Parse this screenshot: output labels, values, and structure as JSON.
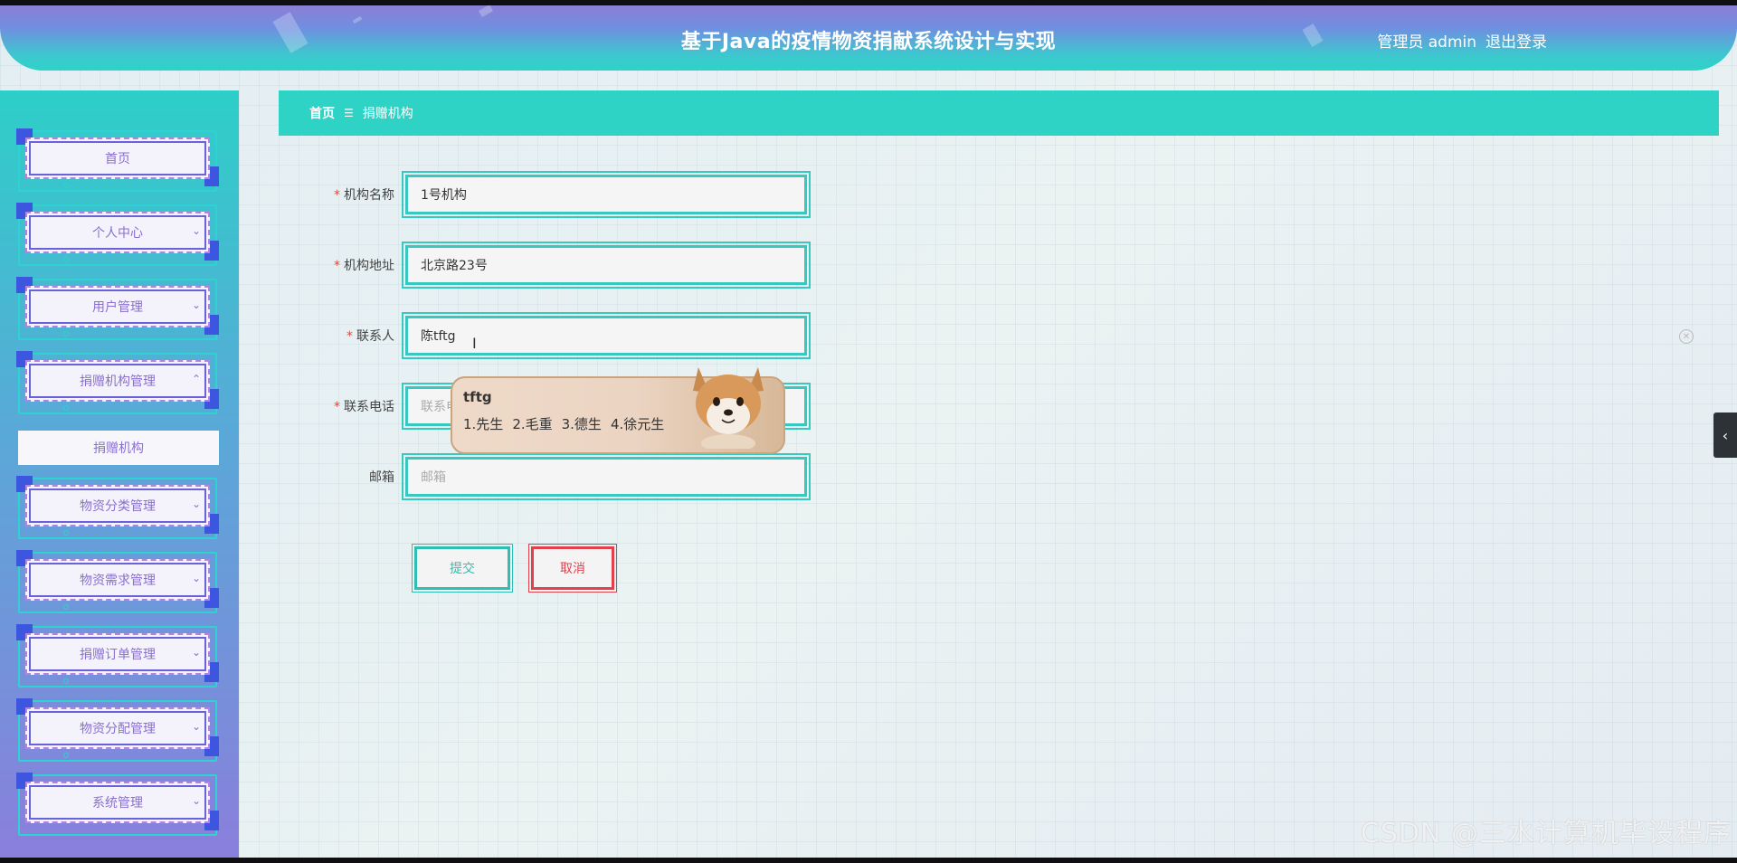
{
  "header": {
    "title": "基于Java的疫情物资捐献系统设计与实现",
    "user_label": "管理员 admin",
    "logout_label": "退出登录"
  },
  "sidebar": {
    "items": [
      {
        "label": "首页",
        "has_chevron": false
      },
      {
        "label": "个人中心",
        "has_chevron": true
      },
      {
        "label": "用户管理",
        "has_chevron": true
      },
      {
        "label": "捐赠机构管理",
        "has_chevron": true,
        "expanded": true
      },
      {
        "label": "物资分类管理",
        "has_chevron": true
      },
      {
        "label": "物资需求管理",
        "has_chevron": true
      },
      {
        "label": "捐赠订单管理",
        "has_chevron": true
      },
      {
        "label": "物资分配管理",
        "has_chevron": true
      },
      {
        "label": "系统管理",
        "has_chevron": true
      }
    ],
    "active_sub_item": "捐赠机构"
  },
  "breadcrumb": {
    "home": "首页",
    "separator": "☰",
    "current": "捐赠机构"
  },
  "form": {
    "fields": [
      {
        "label": "机构名称",
        "required": true,
        "value": "1号机构",
        "placeholder": ""
      },
      {
        "label": "机构地址",
        "required": true,
        "value": "北京路23号",
        "placeholder": ""
      },
      {
        "label": "联系人",
        "required": true,
        "value": "陈tftg",
        "placeholder": ""
      },
      {
        "label": "联系电话",
        "required": true,
        "value": "",
        "placeholder": "联系电话"
      },
      {
        "label": "邮箱",
        "required": false,
        "value": "",
        "placeholder": "邮箱"
      }
    ],
    "submit_label": "提交",
    "cancel_label": "取消",
    "required_mark": "*"
  },
  "ime": {
    "composition": "tftg",
    "candidates": [
      "1.先生",
      "2.毛重",
      "3.德生",
      "4.徐元生"
    ]
  },
  "side_toggle_glyph": "‹",
  "watermark": "CSDN @三水计算机毕设程序",
  "colors": {
    "accent_teal": "#2ed3c6",
    "submit": "#2dbfb3",
    "cancel": "#e2414c",
    "required": "#e8443a",
    "menu_text": "#8a6fd0"
  }
}
